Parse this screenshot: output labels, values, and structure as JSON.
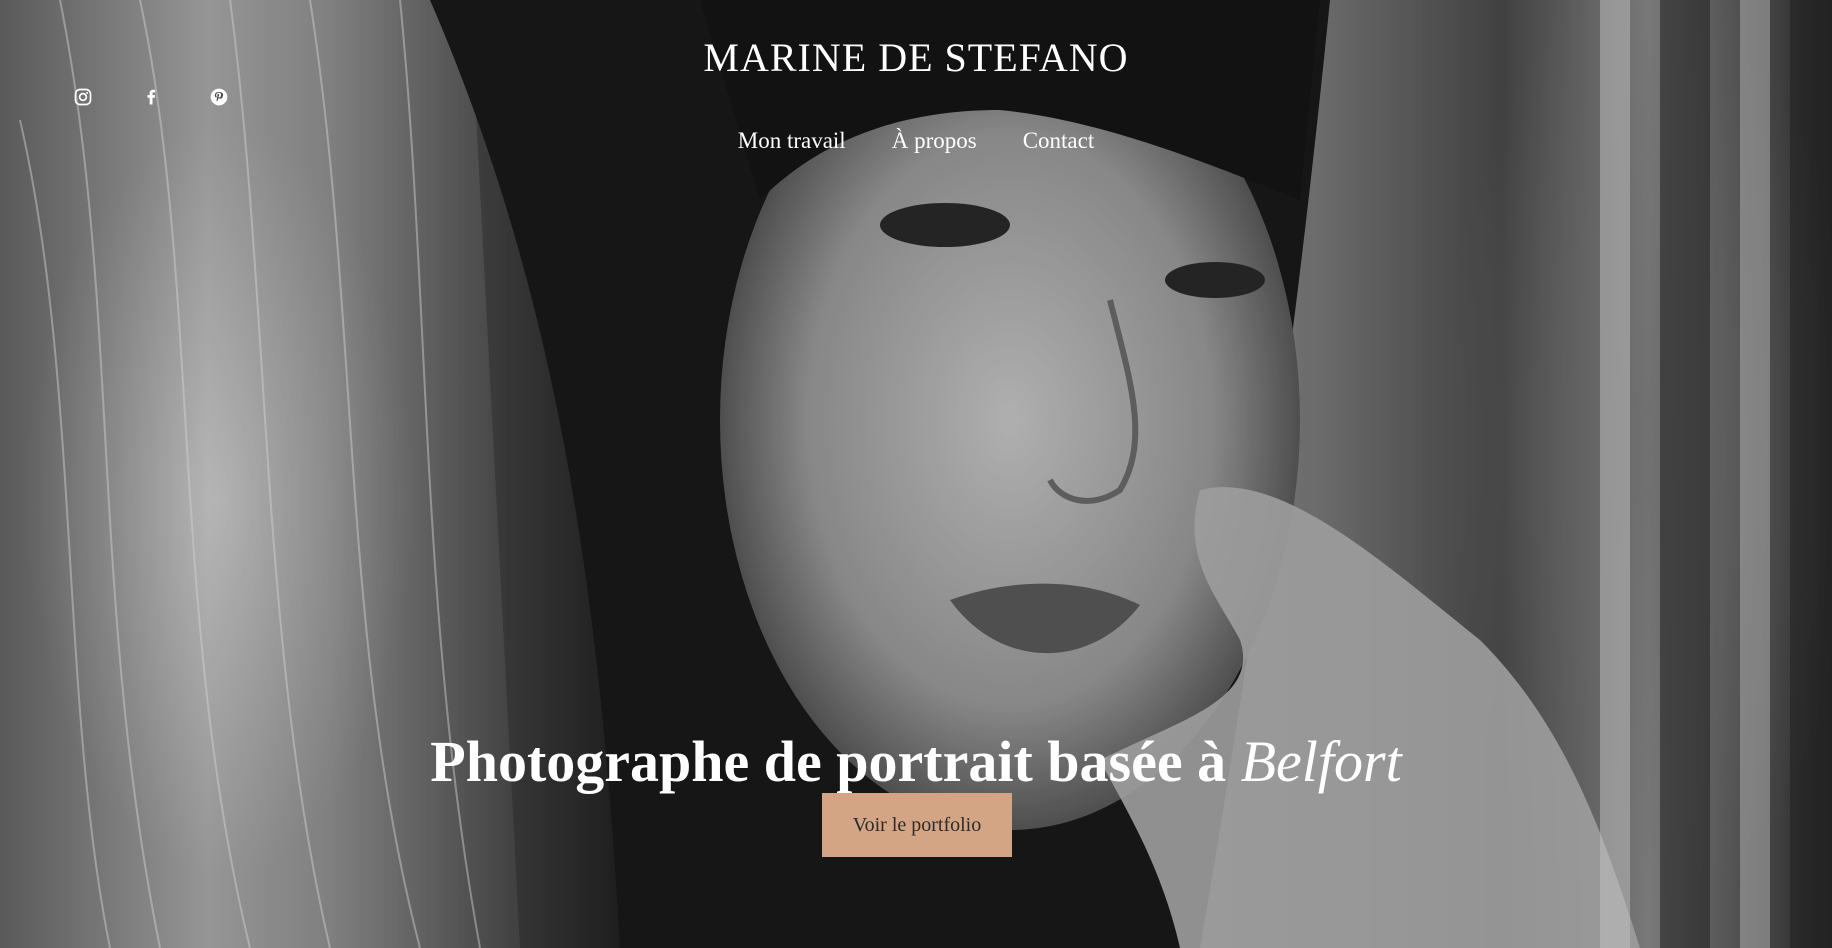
{
  "site": {
    "brand": "MARINE DE STEFANO"
  },
  "social": [
    {
      "name": "instagram",
      "icon": "instagram-icon"
    },
    {
      "name": "facebook",
      "icon": "facebook-icon"
    },
    {
      "name": "pinterest",
      "icon": "pinterest-icon"
    }
  ],
  "nav": {
    "work": "Mon travail",
    "about": "À propos",
    "contact": "Contact"
  },
  "hero": {
    "headline_main": "Photographe de portrait basée à",
    "headline_city": "Belfort",
    "cta_label": "Voir le portfolio",
    "cta_color": "#d4a585"
  }
}
